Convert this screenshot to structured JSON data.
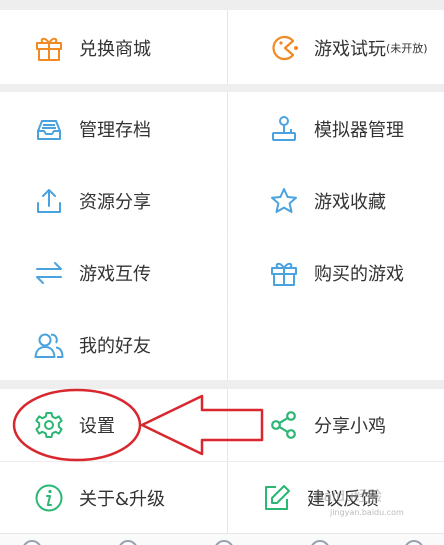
{
  "menu": {
    "row1": {
      "left": {
        "label": "兑换商城",
        "icon": "gift-box-icon"
      },
      "right": {
        "label": "游戏试玩",
        "note": "(未开放)",
        "icon": "pacman-icon"
      }
    },
    "row2": {
      "left": {
        "label": "管理存档",
        "icon": "inbox-tray-icon"
      },
      "right": {
        "label": "模拟器管理",
        "icon": "joystick-icon"
      }
    },
    "row3": {
      "left": {
        "label": "资源分享",
        "icon": "upload-icon"
      },
      "right": {
        "label": "游戏收藏",
        "icon": "star-icon"
      }
    },
    "row4": {
      "left": {
        "label": "游戏互传",
        "icon": "transfer-arrows-icon"
      },
      "right": {
        "label": "购买的游戏",
        "icon": "gift-box-icon"
      }
    },
    "row5": {
      "left": {
        "label": "我的好友",
        "icon": "friends-icon"
      }
    },
    "row6": {
      "left": {
        "label": "设置",
        "icon": "gear-icon"
      },
      "right": {
        "label": "分享小鸡",
        "icon": "share-icon"
      }
    },
    "row7": {
      "left": {
        "label": "关于&升级",
        "icon": "info-icon"
      },
      "right": {
        "label": "建议反馈",
        "icon": "edit-icon"
      }
    }
  },
  "watermark": {
    "text": "Baidu经验",
    "sub": "jingyan.baidu.com"
  },
  "colors": {
    "orange": "#f08a24",
    "blue": "#4aa3df",
    "green": "#2bb673",
    "annotation_red": "#d9272e",
    "divider_band": "#eeeeee"
  }
}
